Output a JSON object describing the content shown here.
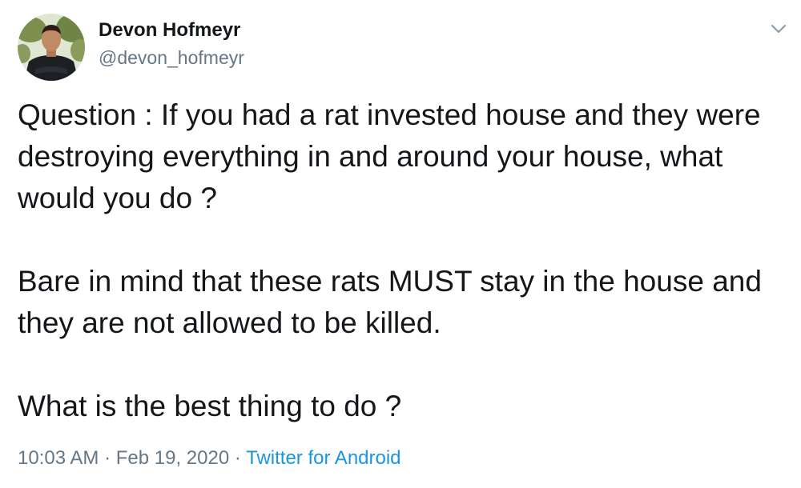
{
  "author": {
    "name": "Devon Hofmeyr",
    "handle": "@devon_hofmeyr",
    "avatar_icon": "profile-photo"
  },
  "menu": {
    "icon": "chevron-down-icon"
  },
  "tweet": {
    "paragraphs": [
      "Question : If you had a rat invested house and they were destroying everything in and around your house, what would you do ?",
      "Bare in mind that these rats MUST stay in the house and they are not allowed to be killed.",
      "What is the best thing to do ?"
    ]
  },
  "meta": {
    "time": "10:03 AM",
    "separator": "·",
    "date": "Feb 19, 2020",
    "source": "Twitter for Android"
  },
  "colors": {
    "text": "#14171a",
    "secondary": "#657786",
    "link": "#1b95e0"
  }
}
